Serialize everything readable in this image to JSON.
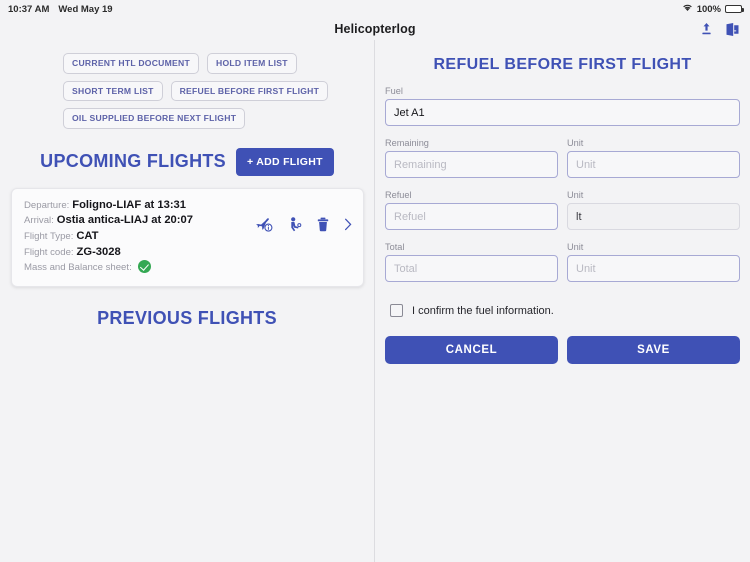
{
  "statusbar": {
    "time": "10:37 AM",
    "date": "Wed May 19",
    "battery_percent": "100%",
    "wifi_icon": "wifi-icon",
    "battery_icon": "battery-icon"
  },
  "header": {
    "title": "Helicopterlog",
    "upload_icon": "upload-icon",
    "logout_icon": "logout-icon"
  },
  "left": {
    "chips": [
      {
        "label": "CURRENT HTL DOCUMENT"
      },
      {
        "label": "HOLD ITEM LIST"
      },
      {
        "label": "SHORT TERM LIST"
      },
      {
        "label": "REFUEL BEFORE FIRST FLIGHT"
      },
      {
        "label": "OIL SUPPLIED BEFORE NEXT FLIGHT"
      }
    ],
    "upcoming_title": "UPCOMING FLIGHTS",
    "add_flight_label": "+ ADD FLIGHT",
    "previous_title": "PREVIOUS FLIGHTS",
    "flight": {
      "departure_label": "Departure:",
      "departure_value": "Foligno-LIAF at 13:31",
      "arrival_label": "Arrival:",
      "arrival_value": "Ostia antica-LIAJ at 20:07",
      "flight_type_label": "Flight Type:",
      "flight_type_value": "CAT",
      "flight_code_label": "Flight code:",
      "flight_code_value": "ZG-3028",
      "mass_balance_label": "Mass and Balance sheet:",
      "mass_balance_status": "complete",
      "actions": [
        "airplane-info-icon",
        "passenger-icon",
        "delete-icon",
        "chevron-right-icon"
      ]
    }
  },
  "form": {
    "title": "REFUEL BEFORE FIRST FLIGHT",
    "fields": [
      {
        "label": "Fuel",
        "value": "Jet A1",
        "placeholder": "Fuel",
        "disabled": false
      },
      {
        "label": "Remaining",
        "value": "",
        "placeholder": "Remaining",
        "disabled": false
      },
      {
        "label": "Unit",
        "value": "",
        "placeholder": "Unit",
        "disabled": false
      },
      {
        "label": "Refuel",
        "value": "",
        "placeholder": "Refuel",
        "disabled": false
      },
      {
        "label": "Unit",
        "value": "lt",
        "placeholder": "Unit",
        "disabled": true
      },
      {
        "label": "Total",
        "value": "",
        "placeholder": "Total",
        "disabled": false
      },
      {
        "label": "Unit",
        "value": "",
        "placeholder": "Unit",
        "disabled": false
      }
    ],
    "confirm_label": "I confirm the fuel information.",
    "confirm_checked": false,
    "cancel_label": "CANCEL",
    "save_label": "SAVE"
  },
  "colors": {
    "accent": "#3f51b5",
    "chip_text": "#5d62a8",
    "success": "#34a853",
    "background": "#f3f3f5"
  }
}
